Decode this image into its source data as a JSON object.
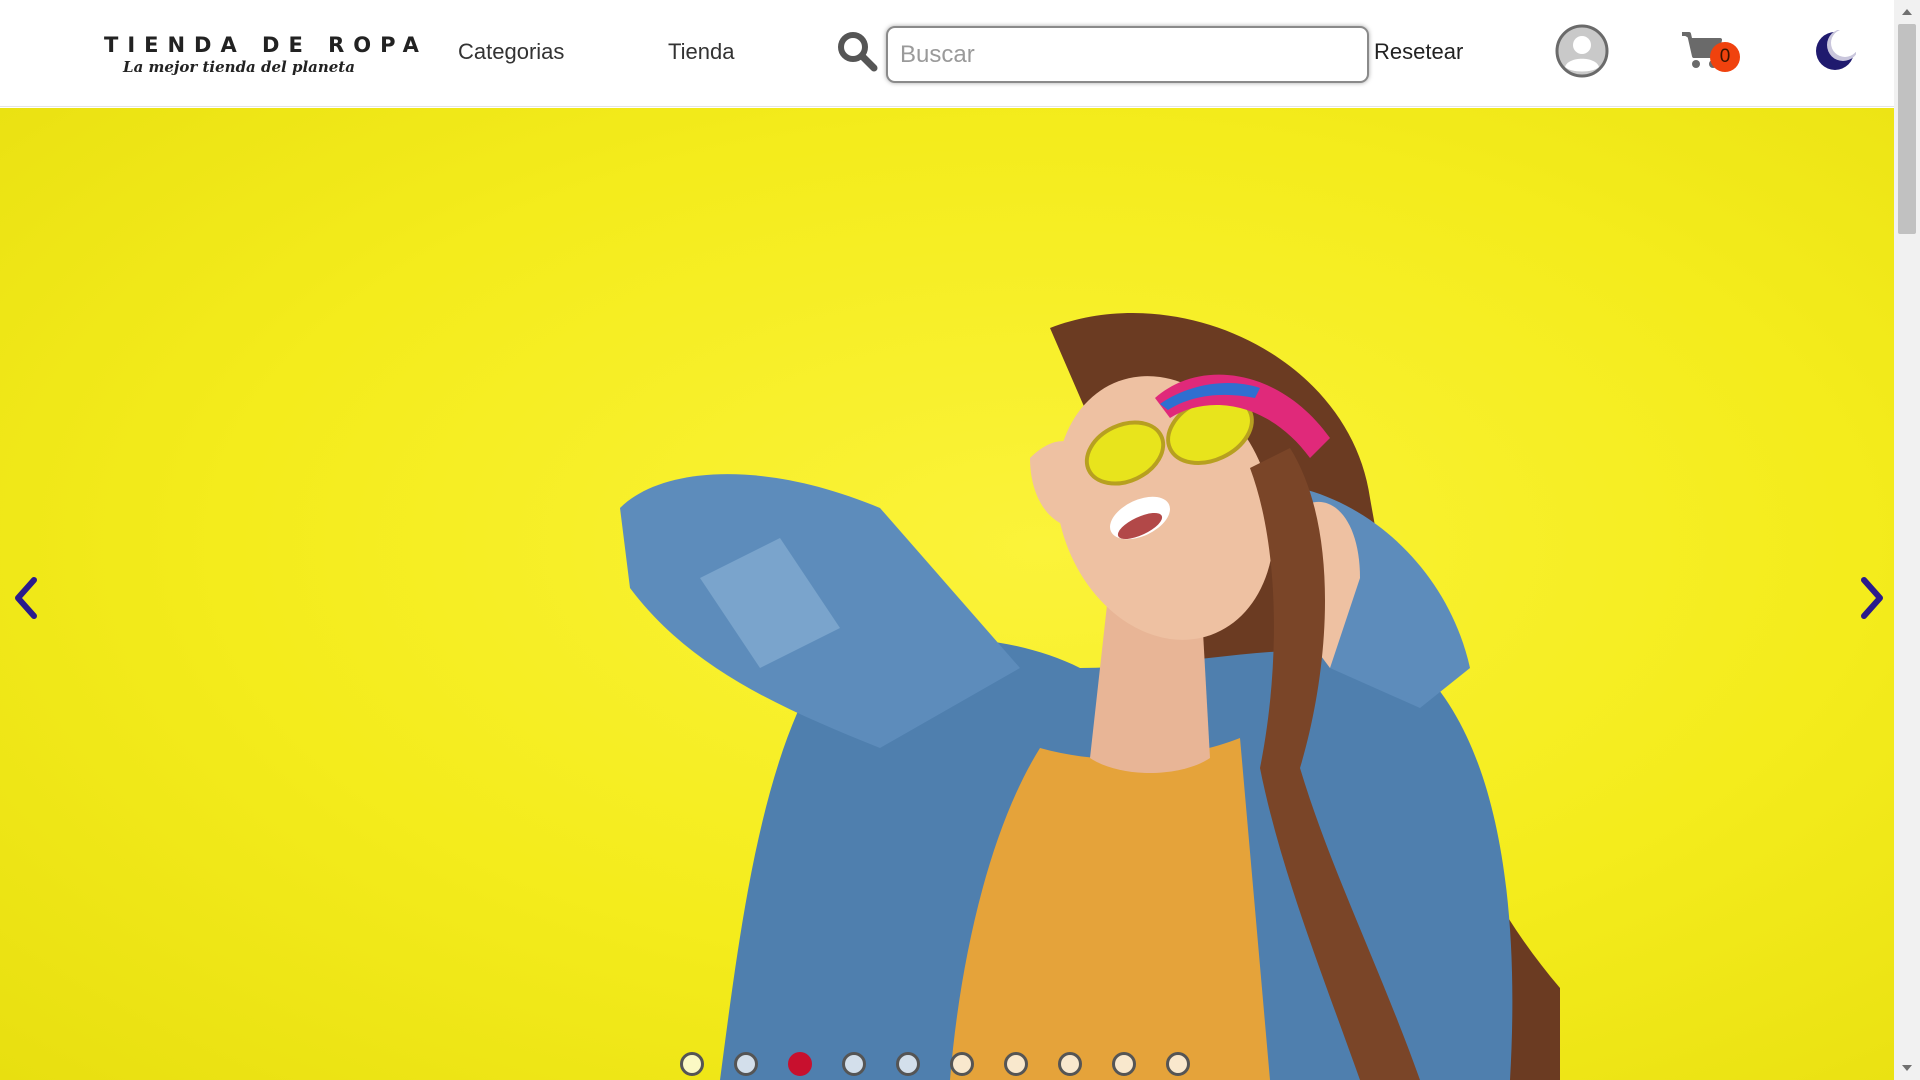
{
  "header": {
    "logo": {
      "title": "TIENDA DE ROPA",
      "tagline": "La mejor tienda del planeta"
    },
    "nav": [
      {
        "label": "Categorias"
      },
      {
        "label": "Tienda"
      }
    ],
    "search": {
      "icon": "search-icon",
      "placeholder": "Buscar",
      "value": ""
    },
    "reset_label": "Resetear",
    "avatar_icon": "user-avatar-icon",
    "cart": {
      "icon": "cart-icon",
      "count": "0"
    },
    "theme_icon": "moon-icon"
  },
  "carousel": {
    "slide_count": 10,
    "active_index": 2,
    "prev_icon": "chevron-left-icon",
    "next_icon": "chevron-right-icon"
  },
  "colors": {
    "hero_background": "#f4ec1c",
    "arrow": "#2a1a8c",
    "active_dot": "#c8102e",
    "cart_badge": "#f0420e"
  }
}
